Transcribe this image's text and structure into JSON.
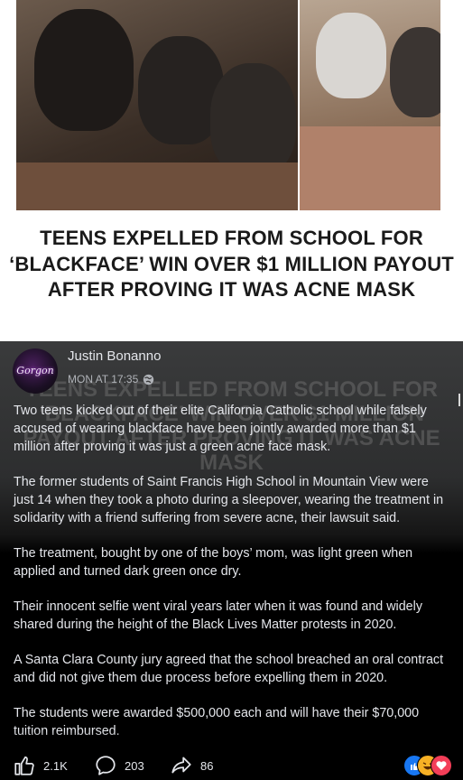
{
  "headline": "TEENS EXPELLED FROM SCHOOL FOR ‘BLACKFACE’ WIN OVER $1 MILLION PAYOUT AFTER PROVING IT WAS ACNE MASK",
  "post": {
    "author": "Justin Bonanno",
    "timestamp": "MON AT 17:35",
    "avatar_text": "Gorgon",
    "ghost_headline": "TEENS EXPELLED FROM SCHOOL FOR ‘BLACKFACE’ WIN OVER $1 MILLION PAYOUT AFTER PROVING IT WAS ACNE MASK",
    "paragraphs": [
      "Two teens kicked out of their elite California Catholic school while falsely accused of wearing blackface have been jointly awarded more than $1 million after proving it was just a green acne face mask.",
      "The former students of Saint Francis High School in Mountain View were just 14 when they took a photo during a sleepover, wearing the treatment in solidarity with a friend suffering from severe acne, their lawsuit said.",
      "The treatment, bought by one of the boys’ mom, was light green when applied and turned dark green once dry.",
      "Their innocent selfie went viral years later when it was found and widely shared during the height of the Black Lives Matter protests in 2020.",
      "A Santa Clara County jury agreed that the school breached an oral contract and did not give them due process before expelling them in 2020.",
      "The students were awarded $500,000 each and will have their $70,000 tuition reimbursed."
    ]
  },
  "actions": {
    "likes": "2.1K",
    "comments": "203",
    "shares": "86"
  },
  "icons": {
    "like": "thumbs-up-icon",
    "comment": "comment-bubble-icon",
    "share": "share-arrow-icon",
    "privacy": "globe-icon"
  },
  "colors": {
    "like_blue": "#1877f2",
    "love_red": "#f33e58",
    "haha_yellow": "#f7b125"
  }
}
